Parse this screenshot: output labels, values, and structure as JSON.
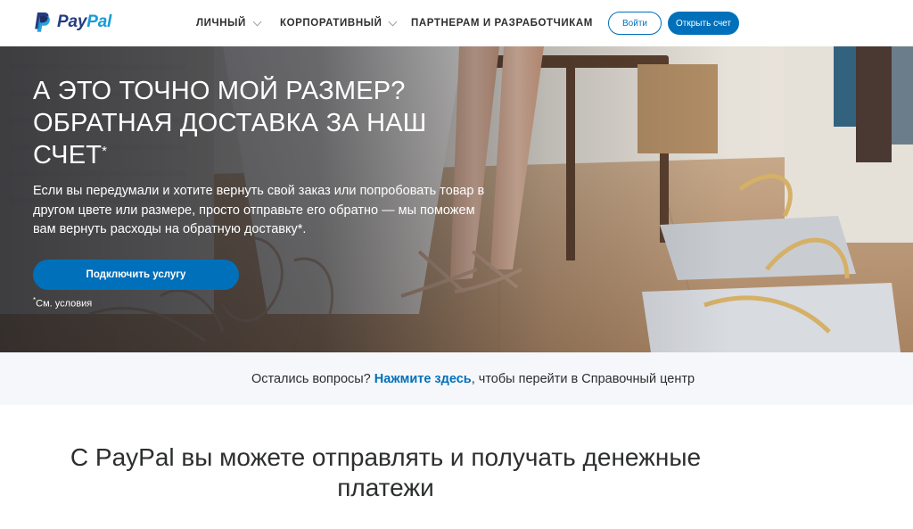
{
  "header": {
    "logo": {
      "pay": "Pay",
      "pal": "Pal",
      "icon": "paypal-p-icon"
    },
    "nav": [
      {
        "label": "ЛИЧНЫЙ",
        "has_dropdown": true
      },
      {
        "label": "КОРПОРАТИВНЫЙ",
        "has_dropdown": true
      },
      {
        "label": "ПАРТНЕРАМ И РАЗРАБОТЧИКАМ",
        "has_dropdown": false
      }
    ],
    "login_label": "Войти",
    "signup_label": "Открыть счет"
  },
  "hero": {
    "title": "А ЭТО ТОЧНО МОЙ РАЗМЕР? ОБРАТНАЯ ДОСТАВКА ЗА НАШ СЧЕТ",
    "title_mark": "*",
    "text": "Если вы передумали и хотите вернуть свой заказ или попробовать товар в другом цвете или размере, просто отправьте его обратно — мы поможем вам вернуть расходы на обратную доставку*.",
    "button_label": "Подключить услугу",
    "terms_mark": "*",
    "terms_label": "См. условия"
  },
  "help": {
    "before": "Остались вопросы? ",
    "link": "Нажмите здесь",
    "after": ", чтобы перейти в Справочный центр"
  },
  "main": {
    "heading": "С PayPal вы можете отправлять и получать денежные платежи"
  },
  "colors": {
    "brand_blue": "#0070ba",
    "logo_dark": "#253b80",
    "logo_light": "#179bd7",
    "help_bg": "#f5f7fa"
  }
}
